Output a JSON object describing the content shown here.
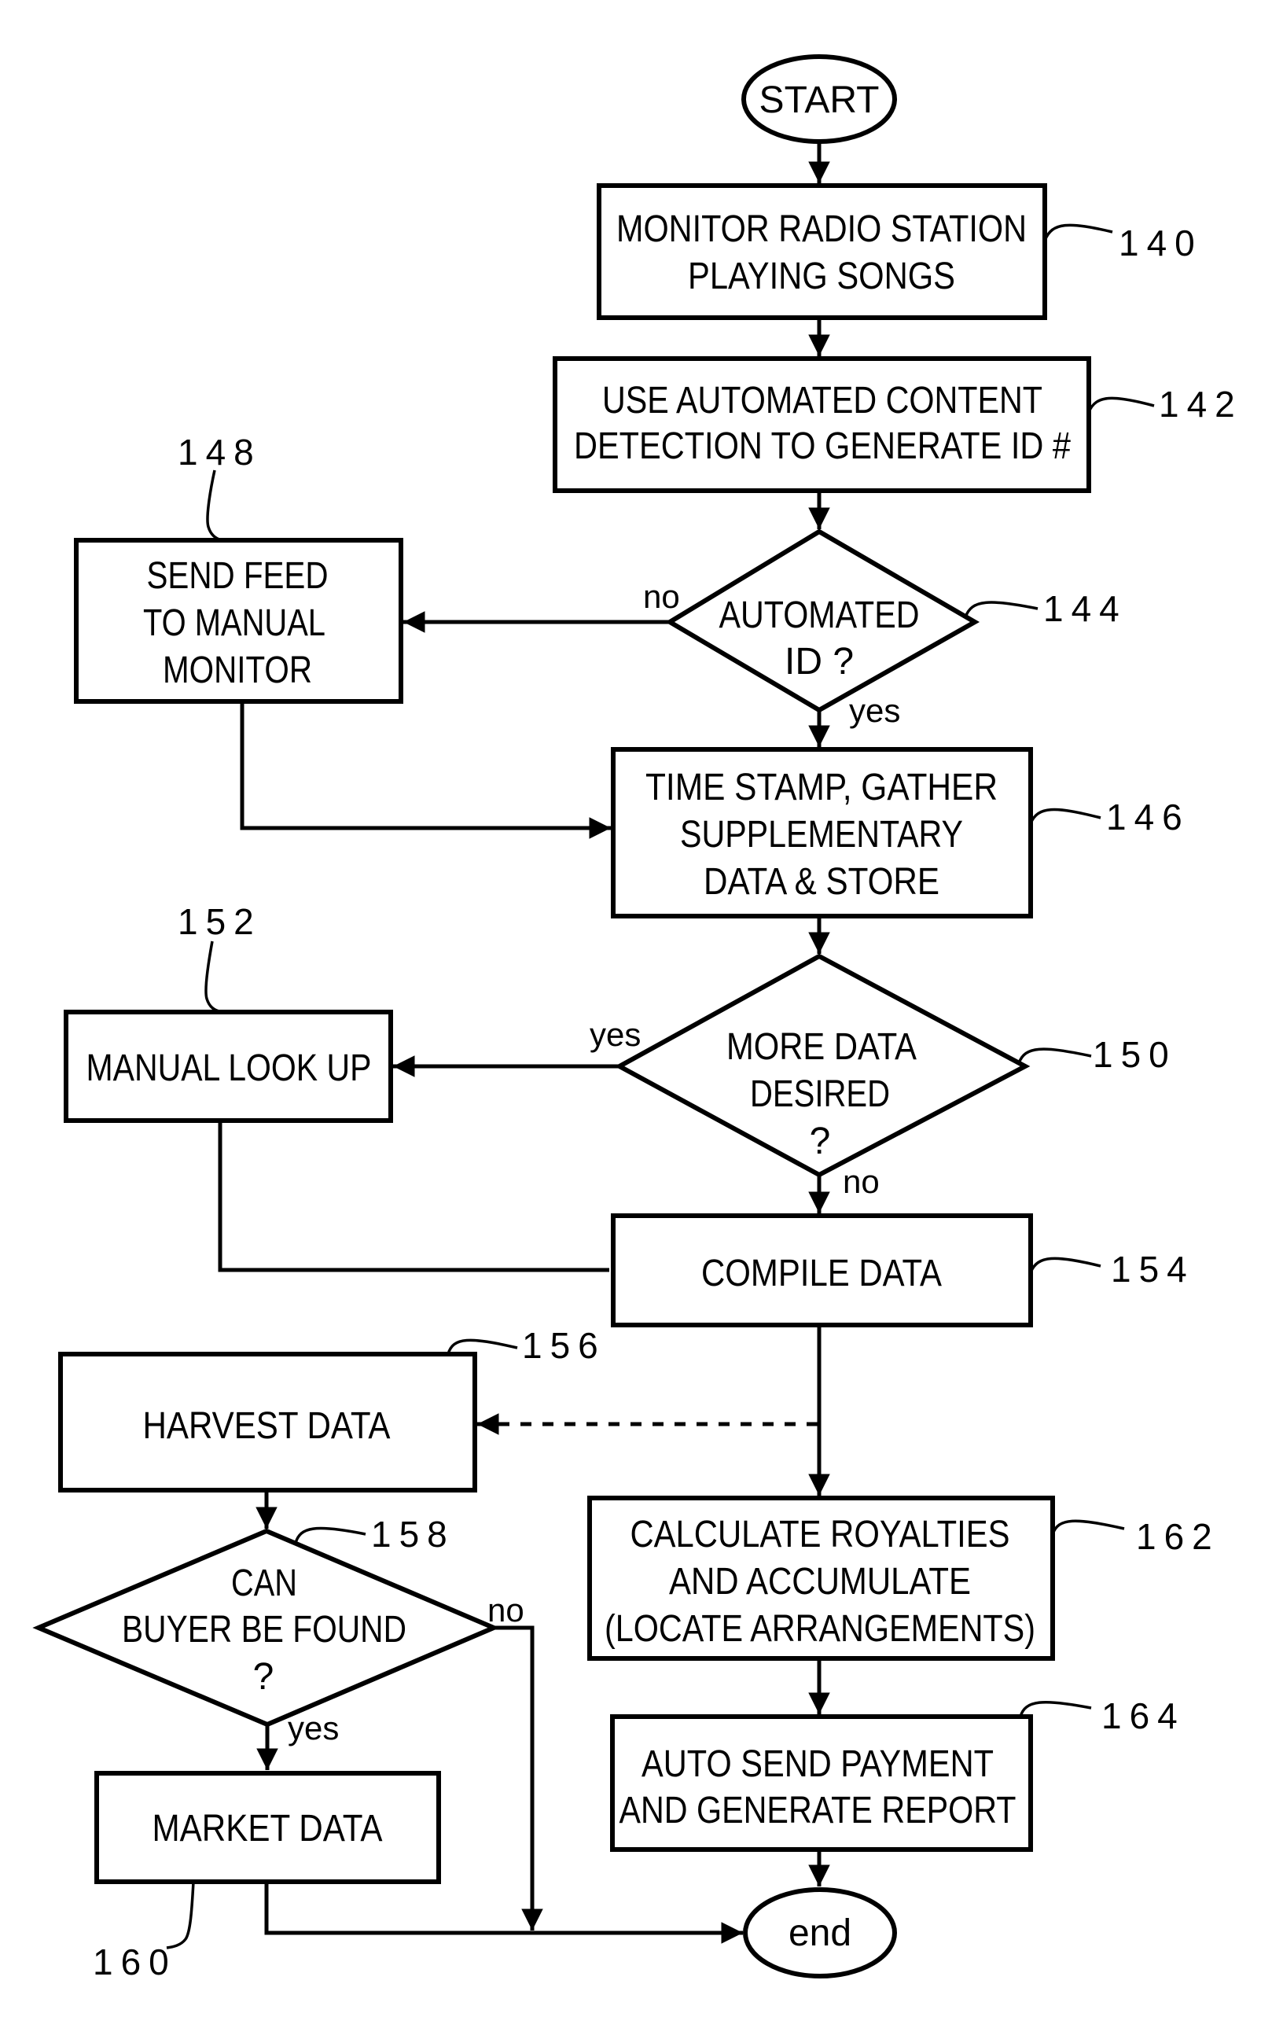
{
  "diagram": {
    "type": "flowchart",
    "start": {
      "text": "START"
    },
    "end": {
      "text": "end"
    },
    "steps": {
      "s140": {
        "ref": "140",
        "lines": [
          "MONITOR RADIO STATION",
          "PLAYING SONGS"
        ]
      },
      "s142": {
        "ref": "142",
        "lines": [
          "USE AUTOMATED CONTENT",
          "DETECTION TO GENERATE ID #"
        ]
      },
      "s144": {
        "ref": "144",
        "lines": [
          "AUTOMATED",
          "ID ?"
        ]
      },
      "s146": {
        "ref": "146",
        "lines": [
          "TIME STAMP, GATHER",
          "SUPPLEMENTARY",
          "DATA & STORE"
        ]
      },
      "s148": {
        "ref": "148",
        "lines": [
          "SEND FEED",
          "TO MANUAL",
          "MONITOR"
        ]
      },
      "s150": {
        "ref": "150",
        "lines": [
          "MORE DATA",
          "DESIRED",
          "?"
        ]
      },
      "s152": {
        "ref": "152",
        "lines": [
          "MANUAL LOOK UP"
        ]
      },
      "s154": {
        "ref": "154",
        "lines": [
          "COMPILE DATA"
        ]
      },
      "s156": {
        "ref": "156",
        "lines": [
          "HARVEST DATA"
        ]
      },
      "s158": {
        "ref": "158",
        "lines": [
          "CAN",
          "BUYER BE FOUND",
          "?"
        ]
      },
      "s160": {
        "ref": "160",
        "lines": [
          "MARKET DATA"
        ]
      },
      "s162": {
        "ref": "162",
        "lines": [
          "CALCULATE ROYALTIES",
          "AND ACCUMULATE",
          "(LOCATE ARRANGEMENTS)"
        ]
      },
      "s164": {
        "ref": "164",
        "lines": [
          "AUTO SEND PAYMENT",
          "AND GENERATE REPORT"
        ]
      }
    },
    "branch_labels": {
      "d144_no": "no",
      "d144_yes": "yes",
      "d150_yes": "yes",
      "d150_no": "no",
      "d158_no": "no",
      "d158_yes": "yes"
    },
    "edges": [
      {
        "from": "START",
        "to": "140",
        "style": "solid"
      },
      {
        "from": "140",
        "to": "142",
        "style": "solid"
      },
      {
        "from": "142",
        "to": "144",
        "style": "solid"
      },
      {
        "from": "144",
        "to": "148",
        "label": "no",
        "style": "solid"
      },
      {
        "from": "144",
        "to": "146",
        "label": "yes",
        "style": "solid"
      },
      {
        "from": "148",
        "to": "146",
        "style": "solid"
      },
      {
        "from": "146",
        "to": "150",
        "style": "solid"
      },
      {
        "from": "150",
        "to": "152",
        "label": "yes",
        "style": "solid"
      },
      {
        "from": "150",
        "to": "154",
        "label": "no",
        "style": "solid"
      },
      {
        "from": "152",
        "to": "154",
        "style": "solid"
      },
      {
        "from": "154",
        "to": "162",
        "style": "solid"
      },
      {
        "from": "154",
        "to": "156",
        "style": "dashed"
      },
      {
        "from": "156",
        "to": "158",
        "style": "solid"
      },
      {
        "from": "158",
        "to": "160",
        "label": "yes",
        "style": "solid"
      },
      {
        "from": "158",
        "to": "end",
        "label": "no",
        "style": "solid"
      },
      {
        "from": "160",
        "to": "end",
        "style": "solid"
      },
      {
        "from": "162",
        "to": "164",
        "style": "solid"
      },
      {
        "from": "164",
        "to": "end",
        "style": "solid"
      }
    ]
  }
}
